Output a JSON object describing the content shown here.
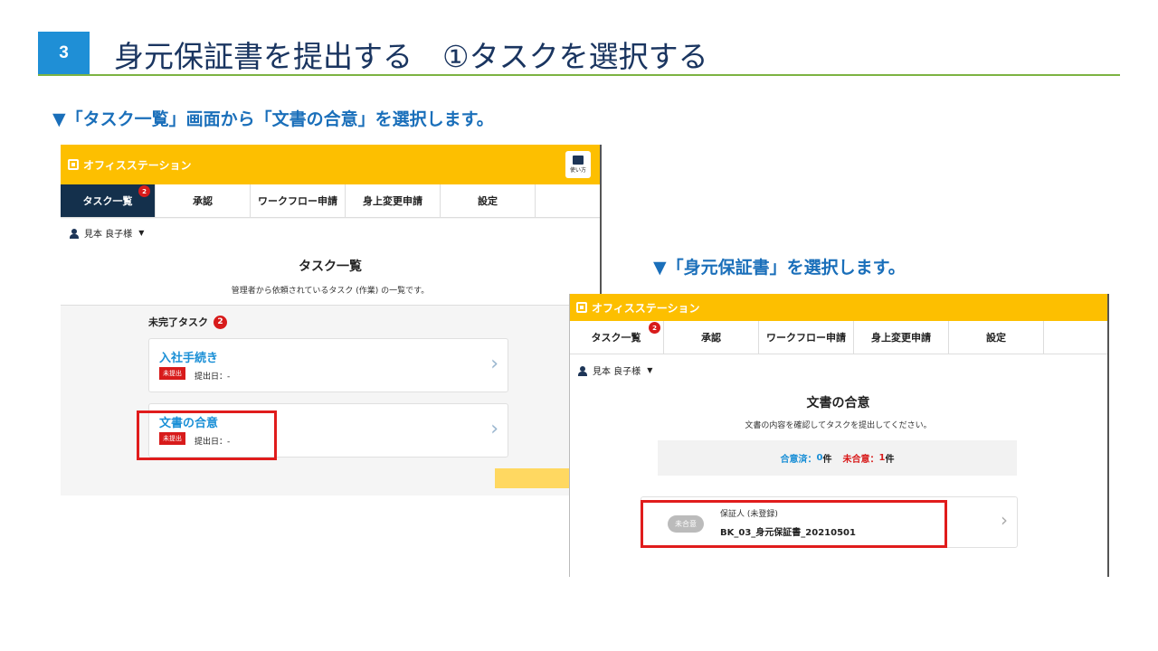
{
  "slide": {
    "step_number": "3",
    "title": "身元保証書を提出する　①タスクを選択する",
    "instruction_1": "▼「タスク一覧」画面から「文書の合意」を選択します。",
    "instruction_2": "▼「身元保証書」を選択します。"
  },
  "colors": {
    "app_bar": "#fdbf00",
    "active_tab": "#14304c",
    "link_blue": "#1a8fd6",
    "badge_red": "#d81b1b",
    "highlight_red": "#e01c1c",
    "title_rule_green": "#7cb342"
  },
  "screen1": {
    "app_name": "オフィスステーション",
    "manual_label": "使い方",
    "tabs": [
      {
        "label": "タスク一覧",
        "badge": "2",
        "active": true
      },
      {
        "label": "承認"
      },
      {
        "label": "ワークフロー申請"
      },
      {
        "label": "身上変更申請"
      },
      {
        "label": "設定"
      }
    ],
    "user_name": "見本 良子様",
    "page_title": "タスク一覧",
    "page_description": "管理者から依頼されているタスク (作業) の一覧です。",
    "section_title": "未完了タスク",
    "section_count": "2",
    "tasks": [
      {
        "name": "入社手続き",
        "status": "未提出",
        "date": "提出日：-"
      },
      {
        "name": "文書の合意",
        "status": "未提出",
        "date": "提出日：-"
      }
    ]
  },
  "screen2": {
    "app_name": "オフィスステーション",
    "tabs": [
      {
        "label": "タスク一覧",
        "badge": "2"
      },
      {
        "label": "承認"
      },
      {
        "label": "ワークフロー申請"
      },
      {
        "label": "身上変更申請"
      },
      {
        "label": "設定"
      }
    ],
    "user_name": "見本 良子様",
    "page_title": "文書の合意",
    "page_description": "文書の内容を確認してタスクを提出してください。",
    "summary": {
      "agreed_label": "合意済：",
      "agreed_count": "0",
      "unagreed_label": "未合意：",
      "unagreed_count": "1",
      "unit": "件"
    },
    "document": {
      "status": "未合意",
      "subtitle": "保証人 (未登録)",
      "name": "BK_03_身元保証書_20210501"
    }
  }
}
